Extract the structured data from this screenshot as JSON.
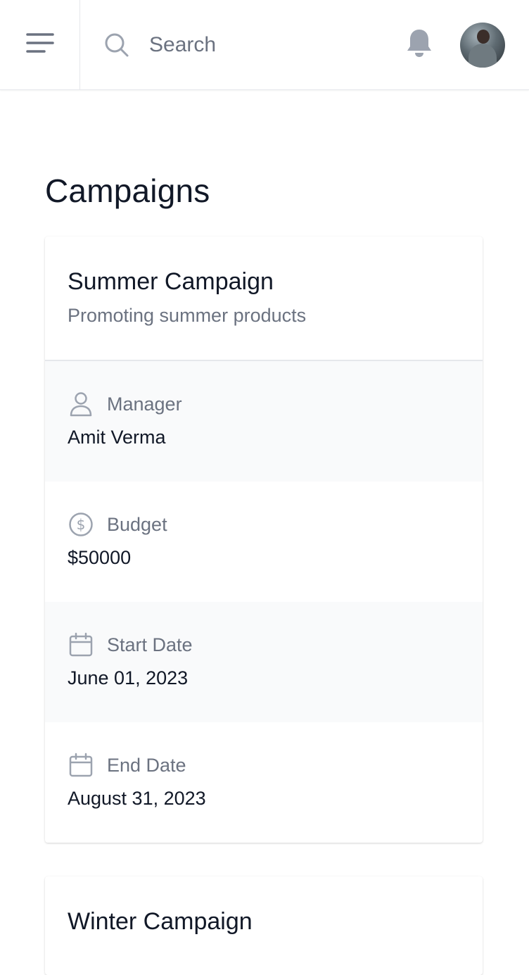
{
  "header": {
    "search_placeholder": "Search"
  },
  "page": {
    "title": "Campaigns"
  },
  "campaigns": [
    {
      "name": "Summer Campaign",
      "description": "Promoting summer products",
      "fields": [
        {
          "label": "Manager",
          "value": "Amit Verma",
          "icon": "user-icon"
        },
        {
          "label": "Budget",
          "value": "$50000",
          "icon": "dollar-icon"
        },
        {
          "label": "Start Date",
          "value": "June 01, 2023",
          "icon": "calendar-icon"
        },
        {
          "label": "End Date",
          "value": "August 31, 2023",
          "icon": "calendar-icon"
        }
      ]
    },
    {
      "name": "Winter Campaign"
    }
  ],
  "colors": {
    "text_primary": "#111827",
    "text_secondary": "#6b7280",
    "icon_gray": "#9ca3af",
    "row_alt_bg": "#f9fafb",
    "border": "#e5e7eb"
  }
}
